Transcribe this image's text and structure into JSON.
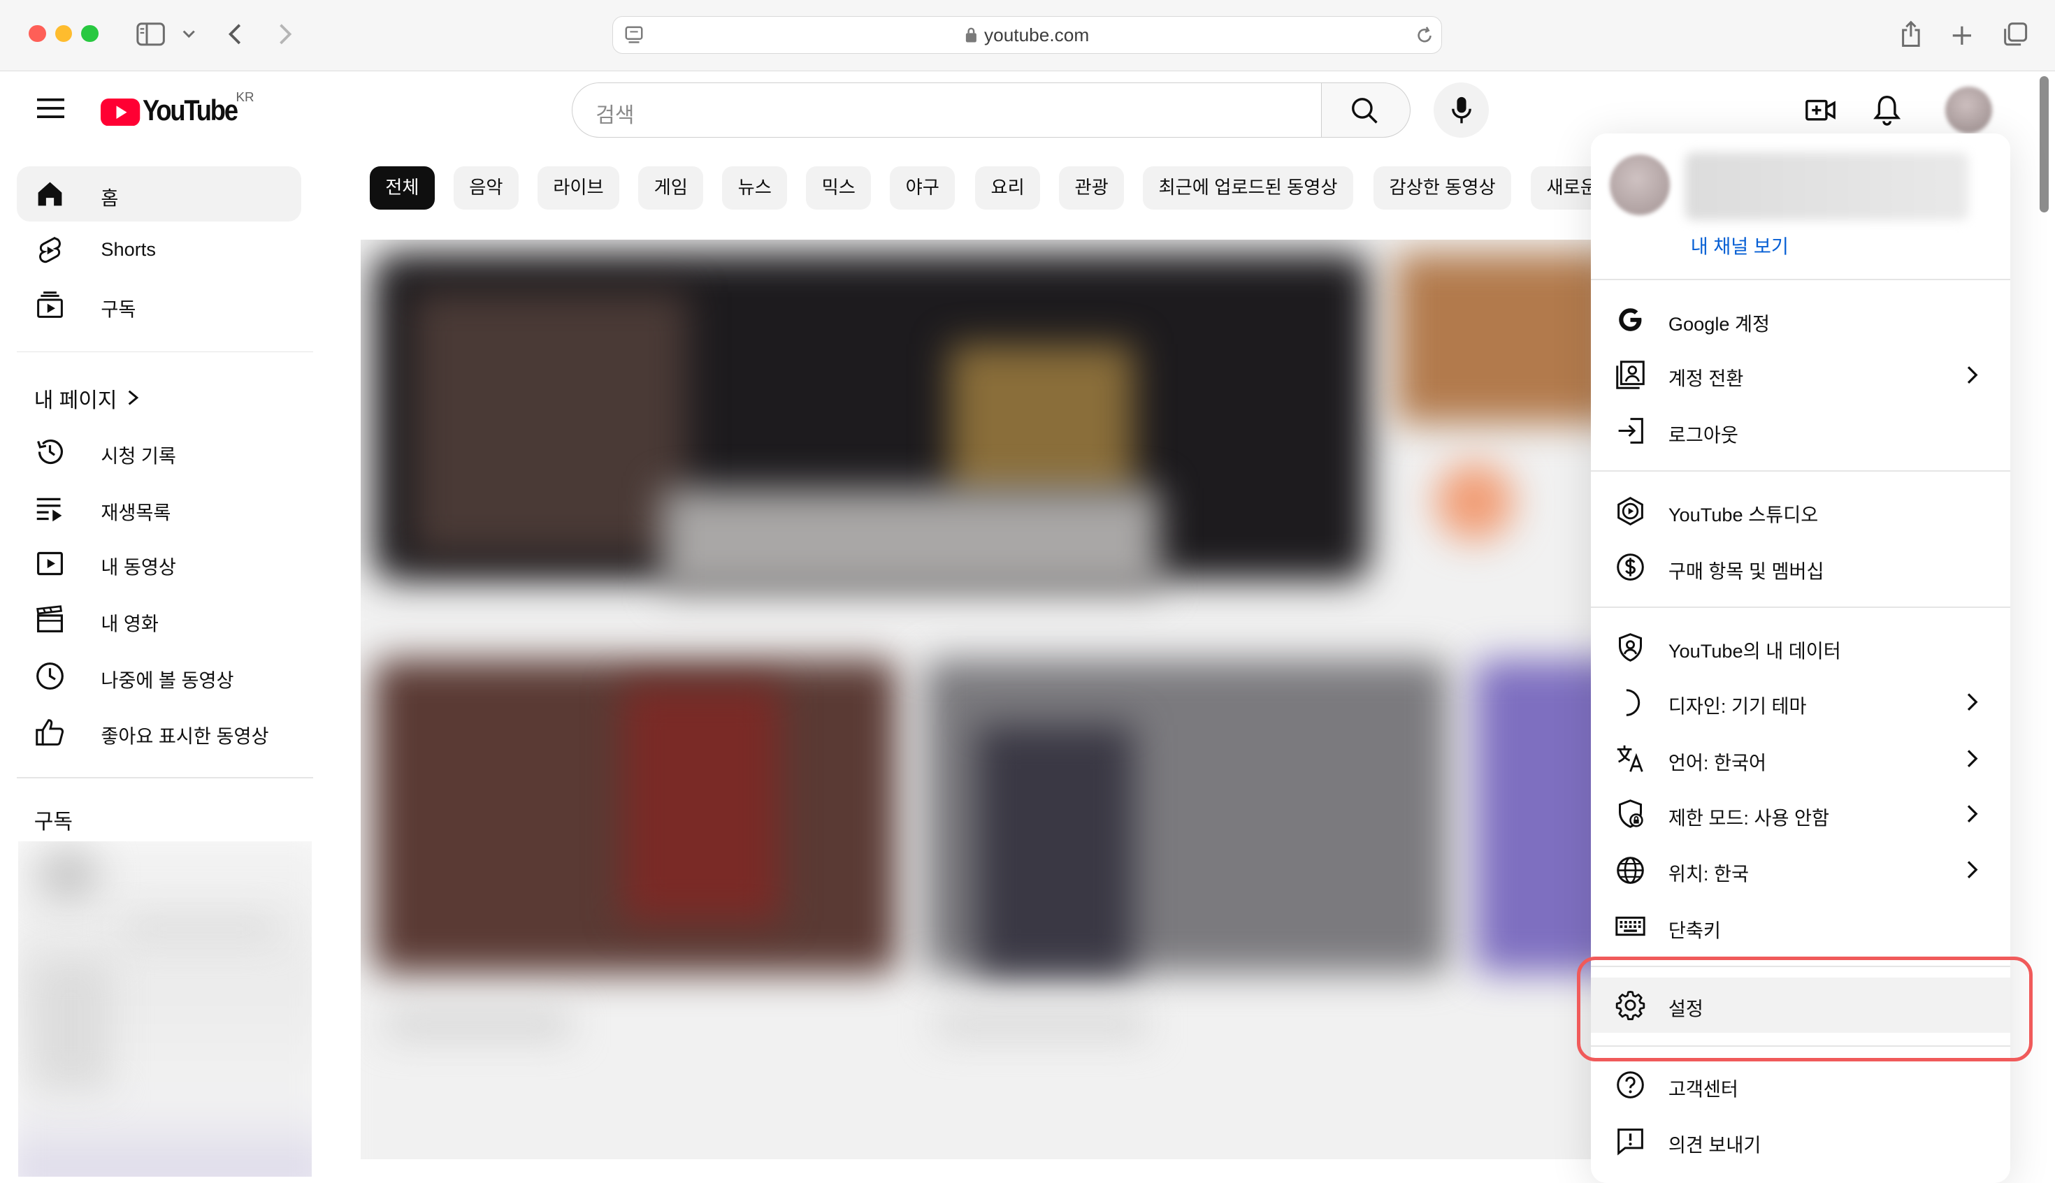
{
  "browser": {
    "url": "youtube.com"
  },
  "header": {
    "logo_text": "YouTube",
    "region": "KR",
    "search_placeholder": "검색"
  },
  "sidebar": {
    "top_items": [
      {
        "label": "홈",
        "icon": "home-icon"
      },
      {
        "label": "Shorts",
        "icon": "shorts-icon"
      },
      {
        "label": "구독",
        "icon": "subscriptions-icon"
      }
    ],
    "my_page_title": "내 페이지",
    "my_items": [
      {
        "label": "시청 기록",
        "icon": "history-icon"
      },
      {
        "label": "재생목록",
        "icon": "playlist-icon"
      },
      {
        "label": "내 동영상",
        "icon": "video-icon"
      },
      {
        "label": "내 영화",
        "icon": "movie-icon"
      },
      {
        "label": "나중에 볼 동영상",
        "icon": "clock-icon"
      },
      {
        "label": "좋아요 표시한 동영상",
        "icon": "thumbs-up-icon"
      }
    ],
    "subscriptions_title": "구독"
  },
  "chips": [
    "전체",
    "음악",
    "라이브",
    "게임",
    "뉴스",
    "믹스",
    "야구",
    "요리",
    "관광",
    "최근에 업로드된 동영상",
    "감상한 동영상",
    "새로운"
  ],
  "account_menu": {
    "view_channel": "내 채널 보기",
    "items": [
      {
        "label": "Google 계정",
        "icon": "google-icon"
      },
      {
        "label": "계정 전환",
        "icon": "switch-account-icon",
        "has_submenu": true
      },
      {
        "label": "로그아웃",
        "icon": "sign-out-icon"
      },
      {
        "label": "YouTube 스튜디오",
        "icon": "studio-icon"
      },
      {
        "label": "구매 항목 및 멤버십",
        "icon": "dollar-icon"
      },
      {
        "label": "YouTube의 내 데이터",
        "icon": "shield-user-icon"
      },
      {
        "label": "디자인: 기기 테마",
        "icon": "moon-icon",
        "has_submenu": true
      },
      {
        "label": "언어: 한국어",
        "icon": "translate-icon",
        "has_submenu": true
      },
      {
        "label": "제한 모드: 사용 안함",
        "icon": "restricted-icon",
        "has_submenu": true
      },
      {
        "label": "위치: 한국",
        "icon": "globe-icon",
        "has_submenu": true
      },
      {
        "label": "단축키",
        "icon": "keyboard-icon"
      },
      {
        "label": "설정",
        "icon": "gear-icon",
        "highlighted": true
      },
      {
        "label": "고객센터",
        "icon": "help-icon"
      },
      {
        "label": "의견 보내기",
        "icon": "feedback-icon"
      }
    ]
  },
  "colors": {
    "youtube_red": "#ff0033",
    "link_blue": "#065fd4",
    "highlight_outline": "#f05a5a"
  }
}
